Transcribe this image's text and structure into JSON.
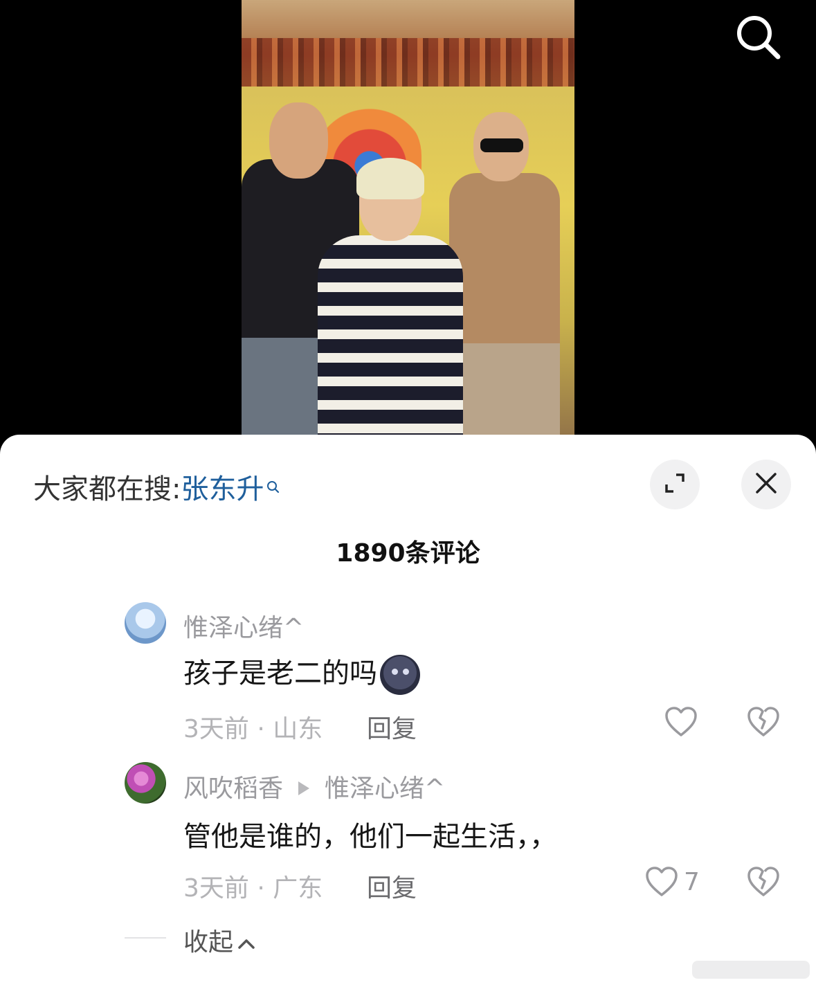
{
  "hot_search": {
    "prefix": "大家都在搜:",
    "term": "张东升"
  },
  "comment_count": "1890条评论",
  "comments": [
    {
      "user": "惟泽心绪^",
      "text": "孩子是老二的吗",
      "emoji": "new-moon-face-emoji",
      "time_location": "3天前 · 山东",
      "reply_label": "回复",
      "likes": ""
    },
    {
      "user": "风吹稻香",
      "reply_to": "惟泽心绪^",
      "text": "管他是谁的，他们一起生活，，",
      "time_location": "3天前 · 广东",
      "reply_label": "回复",
      "likes": "7"
    }
  ],
  "collapse_label": "收起",
  "icons": [
    "search-icon",
    "expand-icon",
    "close-icon",
    "heart-icon",
    "broken-heart-icon",
    "chevron-up-icon"
  ]
}
